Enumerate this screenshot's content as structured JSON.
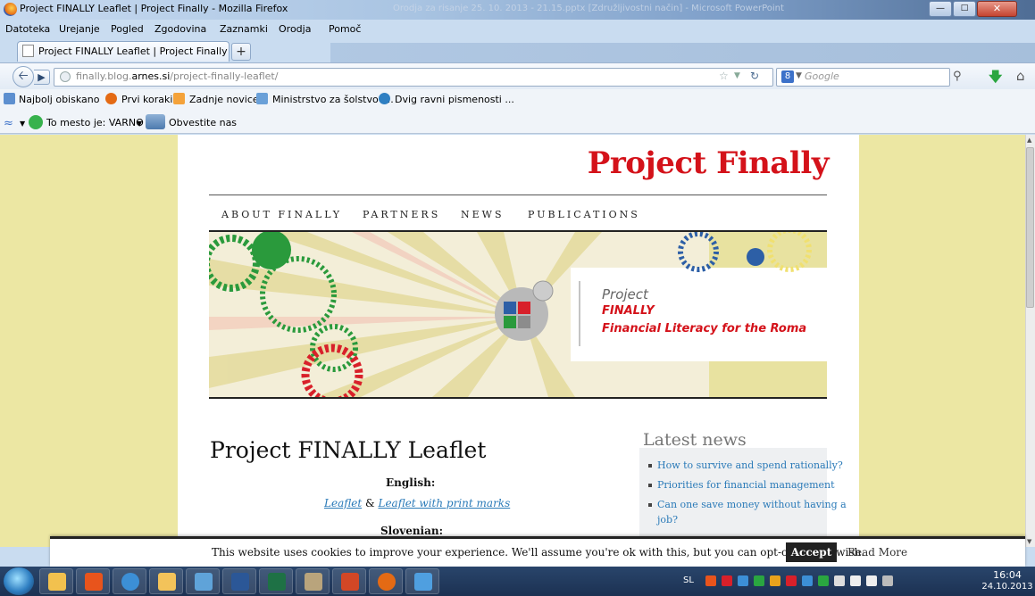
{
  "window": {
    "title": "Project FINALLY Leaflet | Project Finally - Mozilla Firefox",
    "background_title": "Orodja za risanje  25. 10. 2013 - 21.15.pptx [Združljivostni način] - Microsoft PowerPoint"
  },
  "menu": [
    "Datoteka",
    "Urejanje",
    "Pogled",
    "Zgodovina",
    "Zaznamki",
    "Orodja",
    "Pomoč"
  ],
  "tab": {
    "label": "Project FINALLY Leaflet | Project Finally",
    "new_tab": "+"
  },
  "nav": {
    "url_prefix": "finally.blog.",
    "url_domain": "arnes.si",
    "url_path": "/project-finally-leaflet/",
    "search_placeholder": "Google",
    "search_engine": "8"
  },
  "bookmarks": [
    "Najbolj obiskano",
    "Prvi koraki",
    "Zadnje novice",
    "Ministrstvo za šolstvo i...",
    "Dvig ravni pismenosti ..."
  ],
  "toolbar2": {
    "status": "To mesto je: VARNO",
    "report": "Obvestite nas"
  },
  "site": {
    "title": "Project Finally",
    "nav": [
      "ABOUT FINALLY",
      "PARTNERS",
      "NEWS",
      "PUBLICATIONS"
    ],
    "banner": {
      "line1": "Project",
      "line2": "FINALLY",
      "line3": "Financial Literacy for the Roma"
    }
  },
  "post": {
    "title": "Project FINALLY Leaflet",
    "english_heading": "English:",
    "link1": "Leaflet",
    "amp": " & ",
    "link2": "Leaflet with print marks",
    "slovenian_heading": "Slovenian:"
  },
  "sidebar": {
    "heading": "Latest news",
    "items": [
      "How to survive and spend rationally?",
      "Priorities for financial management",
      "Can one save money without having a",
      "job?"
    ]
  },
  "cookie": {
    "text": "This website uses cookies to improve your experience. We'll assume you're ok with this, but you can opt-out if you wish.",
    "accept": "Accept",
    "read_more": "Read More"
  },
  "taskbar": {
    "lang": "SL",
    "time": "16:04",
    "date": "24.10.2013"
  },
  "colors": {
    "site_title": "#d4121a",
    "page_bg": "#ece7a3",
    "link": "#2a7ab8"
  }
}
